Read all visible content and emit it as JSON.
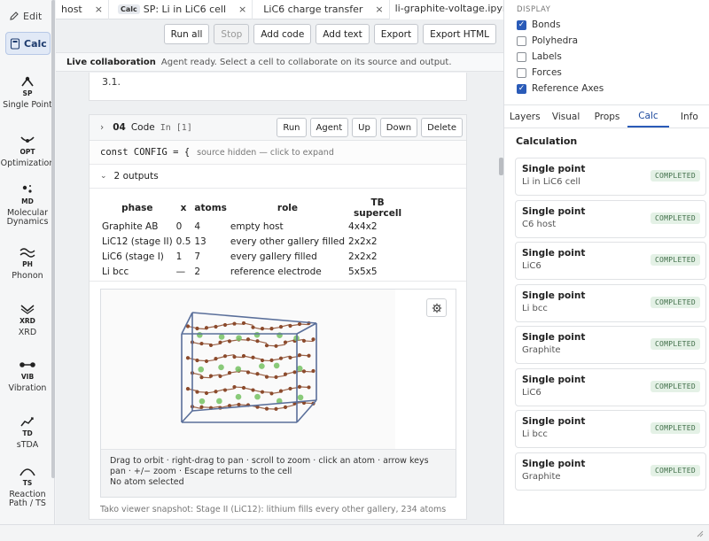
{
  "rail": {
    "edit_label": "Edit",
    "calc_label": "Calc",
    "items": [
      {
        "abbr": "SP",
        "label": "Single Point"
      },
      {
        "abbr": "OPT",
        "label": "Optimization"
      },
      {
        "abbr": "MD",
        "label": "Molecular Dynamics"
      },
      {
        "abbr": "PH",
        "label": "Phonon"
      },
      {
        "abbr": "XRD",
        "label": "XRD"
      },
      {
        "abbr": "VIB",
        "label": "Vibration"
      },
      {
        "abbr": "TD",
        "label": "sTDA"
      },
      {
        "abbr": "TS",
        "label": "Reaction Path / TS"
      }
    ]
  },
  "tabs": [
    {
      "label": "host",
      "badge": "",
      "active": false
    },
    {
      "label": "SP: Li in LiC6 cell",
      "badge": "Calc",
      "active": false
    },
    {
      "label": "LiC6 charge transfer",
      "badge": "",
      "active": false
    },
    {
      "label": "li-graphite-voltage.ipynb",
      "badge": "",
      "active": true
    }
  ],
  "toolbar": {
    "run_all": "Run all",
    "stop": "Stop",
    "add_code": "Add code",
    "add_text": "Add text",
    "export": "Export",
    "export_html": "Export HTML"
  },
  "collab": {
    "title": "Live collaboration",
    "message": "Agent ready. Select a cell to collaborate on its source and output."
  },
  "prev_cell_text": "3.1.",
  "cell": {
    "number": "04",
    "kind": "Code",
    "exec": "In [1]",
    "actions": {
      "run": "Run",
      "agent": "Agent",
      "up": "Up",
      "down": "Down",
      "delete": "Delete"
    },
    "code": "const CONFIG = {",
    "code_hint": "source hidden — click to expand",
    "outputs_label": "2 outputs",
    "table": {
      "headers": [
        "phase",
        "x",
        "atoms",
        "role",
        "TB supercell"
      ],
      "rows": [
        [
          "Graphite AB",
          "0",
          "4",
          "empty host",
          "4x4x2"
        ],
        [
          "LiC12 (stage II)",
          "0.5",
          "13",
          "every other gallery filled",
          "2x2x2"
        ],
        [
          "LiC6 (stage I)",
          "1",
          "7",
          "every gallery filled",
          "2x2x2"
        ],
        [
          "Li bcc",
          "—",
          "2",
          "reference electrode",
          "5x5x5"
        ]
      ]
    },
    "viewer": {
      "hint": "Drag to orbit · right-drag to pan · scroll to zoom · click an atom · arrow keys pan · +/− zoom · Escape returns to the cell",
      "selection": "No atom selected",
      "caption": "Tako viewer snapshot: Stage II (LiC12): lithium fills every other gallery, 234 atoms",
      "carbon_color": "#8b4a2c",
      "lithium_color": "#7cc46a",
      "cell_color": "#5a6f9a"
    }
  },
  "display": {
    "title": "DISPLAY",
    "options": [
      {
        "label": "Bonds",
        "checked": true
      },
      {
        "label": "Polyhedra",
        "checked": false
      },
      {
        "label": "Labels",
        "checked": false
      },
      {
        "label": "Forces",
        "checked": false
      },
      {
        "label": "Reference Axes",
        "checked": true
      }
    ]
  },
  "right_tabs": [
    {
      "label": "Layers",
      "active": false
    },
    {
      "label": "Visual",
      "active": false
    },
    {
      "label": "Props",
      "active": false
    },
    {
      "label": "Calc",
      "active": true
    },
    {
      "label": "Info",
      "active": false
    }
  ],
  "calculation": {
    "title": "Calculation",
    "items": [
      {
        "type": "Single point",
        "system": "Li in LiC6 cell",
        "status": "COMPLETED"
      },
      {
        "type": "Single point",
        "system": "C6 host",
        "status": "COMPLETED"
      },
      {
        "type": "Single point",
        "system": "LiC6",
        "status": "COMPLETED"
      },
      {
        "type": "Single point",
        "system": "Li bcc",
        "status": "COMPLETED"
      },
      {
        "type": "Single point",
        "system": "Graphite",
        "status": "COMPLETED"
      },
      {
        "type": "Single point",
        "system": "LiC6",
        "status": "COMPLETED"
      },
      {
        "type": "Single point",
        "system": "Li bcc",
        "status": "COMPLETED"
      },
      {
        "type": "Single point",
        "system": "Graphite",
        "status": "COMPLETED"
      }
    ]
  }
}
